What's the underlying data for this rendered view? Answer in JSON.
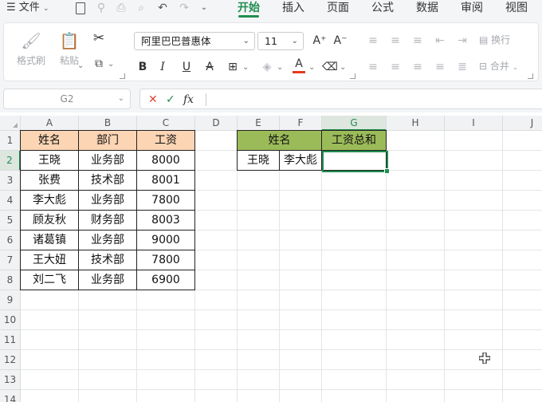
{
  "menu": {
    "file_label": "文件",
    "tabs": [
      "开始",
      "插入",
      "页面",
      "公式",
      "数据",
      "审阅",
      "视图"
    ],
    "active_tab": 0
  },
  "ribbon": {
    "format_painter": "格式刷",
    "paste": "粘贴",
    "font_name": "阿里巴巴普惠体",
    "font_size": "11",
    "wrap": "换行",
    "merge": "合并"
  },
  "formula_bar": {
    "cell_ref": "G2",
    "cancel": "✕",
    "confirm": "✓",
    "fx": "fx",
    "formula": ""
  },
  "grid": {
    "columns": [
      "A",
      "B",
      "C",
      "D",
      "E",
      "F",
      "G",
      "H",
      "I",
      "J"
    ],
    "rows": [
      "1",
      "2",
      "3",
      "4",
      "5",
      "6",
      "7",
      "8",
      "9",
      "10",
      "11",
      "12",
      "13",
      "14"
    ],
    "selected_cell": "G2",
    "left_table": {
      "headers": [
        "姓名",
        "部门",
        "工资"
      ],
      "rows": [
        [
          "王晓",
          "业务部",
          "8000"
        ],
        [
          "张费",
          "技术部",
          "8001"
        ],
        [
          "李大彪",
          "业务部",
          "7800"
        ],
        [
          "顾友秋",
          "财务部",
          "8003"
        ],
        [
          "诸葛镇",
          "业务部",
          "9000"
        ],
        [
          "王大妞",
          "技术部",
          "7800"
        ],
        [
          "刘二飞",
          "业务部",
          "6900"
        ]
      ],
      "header_color": "#fcd5b4"
    },
    "right_table": {
      "header_name": "姓名",
      "header_total": "工资总和",
      "names": [
        "王晓",
        "李大彪"
      ],
      "total": "",
      "header_color": "#9bbb59"
    }
  },
  "colors": {
    "accent": "#1e8e4f"
  }
}
